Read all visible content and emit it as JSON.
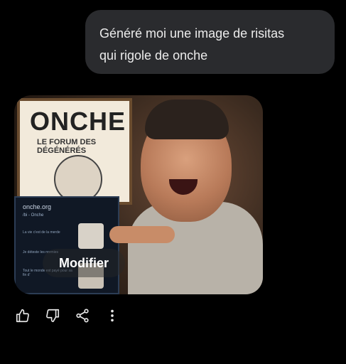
{
  "chat": {
    "user_message": "Généré moi une image de risitas\nqui rigole de onche"
  },
  "image_card": {
    "poster_title": "ONCHE",
    "poster_subtitle": "LE FORUM DES DÉGÉNÉRÉS",
    "phone_domain": "onche.org",
    "phone_board": "/bi - Onche",
    "phone_post1": "La vie c'est de la merde",
    "phone_post2": "Je déteste les normies",
    "phone_post3": "Tout le monde est payé pour sa fin d'",
    "edit_label": "Modifier"
  },
  "actions": {
    "items": [
      {
        "name": "thumbs-up-icon"
      },
      {
        "name": "thumbs-down-icon"
      },
      {
        "name": "share-icon"
      },
      {
        "name": "more-vertical-icon"
      }
    ]
  }
}
